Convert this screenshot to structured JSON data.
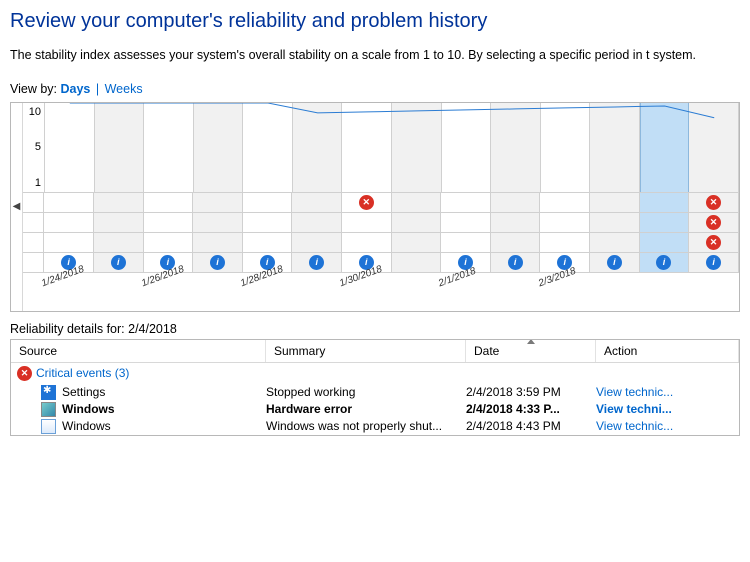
{
  "title": "Review your computer's reliability and problem history",
  "description": "The stability index assesses your system's overall stability on a scale from 1 to 10. By selecting a specific period in t system.",
  "viewby": {
    "label": "View by:",
    "days": "Days",
    "weeks": "Weeks"
  },
  "chart_data": {
    "type": "line",
    "ylabel": "",
    "xlabel": "",
    "ylim": [
      1,
      10
    ],
    "yticks": [
      10,
      5,
      1
    ],
    "categories": [
      "1/24/2018",
      "",
      "1/26/2018",
      "",
      "1/28/2018",
      "",
      "1/30/2018",
      "",
      "2/1/2018",
      "",
      "2/3/2018",
      "",
      "",
      ""
    ],
    "stability_index": [
      10,
      10,
      10,
      10,
      10,
      9,
      9.1,
      9.2,
      9.3,
      9.4,
      9.5,
      9.6,
      9.7,
      8.5
    ],
    "selected_index": 12,
    "event_rows": [
      {
        "type": "error",
        "cells": [
          0,
          0,
          0,
          0,
          0,
          0,
          1,
          0,
          0,
          0,
          0,
          0,
          0,
          1
        ]
      },
      {
        "type": "error",
        "cells": [
          0,
          0,
          0,
          0,
          0,
          0,
          0,
          0,
          0,
          0,
          0,
          0,
          0,
          1
        ]
      },
      {
        "type": "error",
        "cells": [
          0,
          0,
          0,
          0,
          0,
          0,
          0,
          0,
          0,
          0,
          0,
          0,
          0,
          1
        ]
      },
      {
        "type": "info",
        "cells": [
          1,
          1,
          1,
          1,
          1,
          1,
          1,
          0,
          1,
          1,
          1,
          1,
          1,
          1
        ]
      }
    ]
  },
  "details": {
    "label_prefix": "Reliability details for:",
    "date": "2/4/2018",
    "columns": {
      "source": "Source",
      "summary": "Summary",
      "date": "Date",
      "action": "Action"
    },
    "group": {
      "icon": "error",
      "label": "Critical events (3)"
    },
    "rows": [
      {
        "icon": "gear",
        "source": "Settings",
        "summary": "Stopped working",
        "date": "2/4/2018 3:59 PM",
        "action": "View  technic...",
        "bold": false
      },
      {
        "icon": "win",
        "source": "Windows",
        "summary": "Hardware error",
        "date": "2/4/2018 4:33 P...",
        "action": "View  techni...",
        "bold": true
      },
      {
        "icon": "win2",
        "source": "Windows",
        "summary": "Windows was not properly shut...",
        "date": "2/4/2018 4:43 PM",
        "action": "View  technic...",
        "bold": false
      }
    ]
  }
}
